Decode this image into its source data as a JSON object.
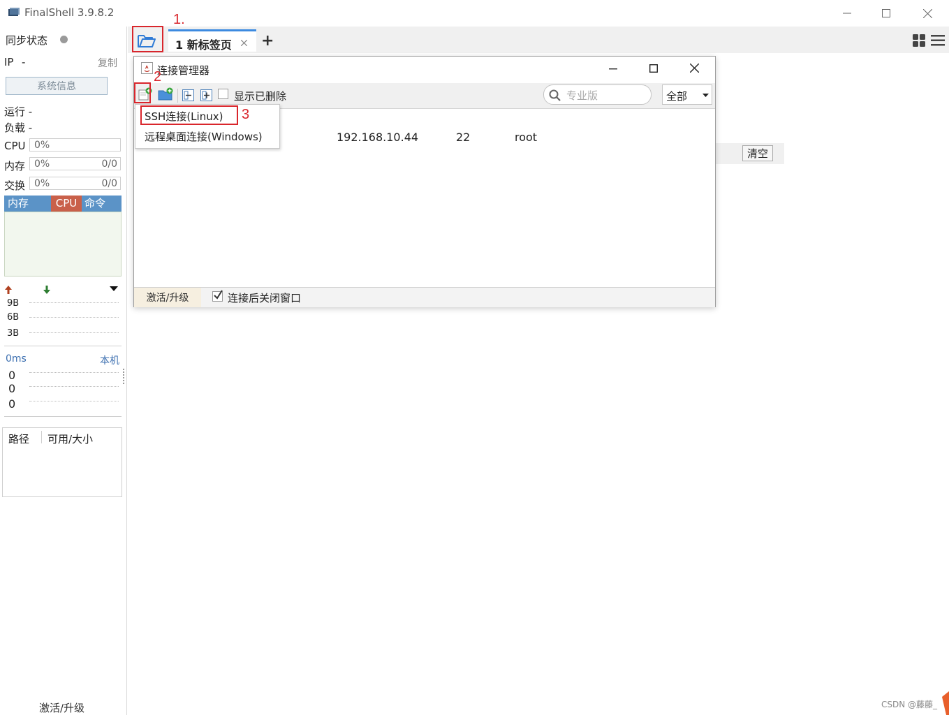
{
  "app": {
    "title": "FinalShell 3.9.8.2"
  },
  "sidebar": {
    "sync_label": "同步状态",
    "ip_label": "IP",
    "ip_value": "-",
    "copy_label": "复制",
    "sysinfo_button": "系统信息",
    "run_label": "运行 -",
    "load_label": "负载 -",
    "cpu_label": "CPU",
    "cpu_value": "0%",
    "mem_label": "内存",
    "mem_value": "0%",
    "mem_count": "0/0",
    "swap_label": "交换",
    "swap_value": "0%",
    "swap_count": "0/0",
    "proc_tabs": [
      "内存",
      "CPU",
      "命令"
    ],
    "net_ticks": [
      "9B",
      "6B",
      "3B"
    ],
    "ping_label": "0ms",
    "ping_host": "本机",
    "ping_values": [
      "0",
      "0",
      "0"
    ],
    "disk_path": "路径",
    "disk_size": "可用/大小",
    "upgrade": "激活/升级"
  },
  "tabs": {
    "tab1_label": "1 新标签页",
    "add_tab": "+"
  },
  "main": {
    "clear_button": "清空"
  },
  "dialog": {
    "title": "连接管理器",
    "show_deleted": "显示已删除",
    "search_placeholder": "专业版",
    "filter_value": "全部",
    "row": {
      "host": "192.168.10.44",
      "port": "22",
      "user": "root"
    },
    "upgrade_button": "激活/升级",
    "close_after_connect": "连接后关闭窗口"
  },
  "popup_menu": {
    "items": [
      "SSH连接(Linux)",
      "远程桌面连接(Windows)"
    ]
  },
  "annotations": [
    "1.",
    "2",
    "3"
  ],
  "watermark": "CSDN @藤藤_",
  "colors": {
    "accent_blue": "#3c8ae0",
    "annotation_red": "#d9262c",
    "cpu_tab": "#c9604a",
    "proc_header": "#5b93c7"
  }
}
